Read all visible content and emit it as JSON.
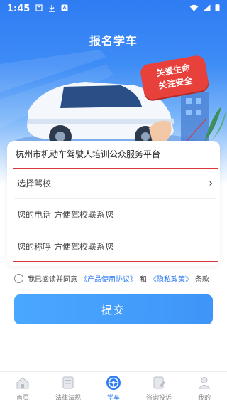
{
  "status_bar": {
    "time": "1:45"
  },
  "header": {
    "title": "报名学车"
  },
  "banner": {
    "badge_line1": "关爱生命",
    "badge_line2": "关注安全"
  },
  "form": {
    "org_name": "杭州市机动车驾驶人培训公众服务平台",
    "school_select": {
      "label": "选择驾校"
    },
    "phone_field": {
      "placeholder": "您的电话 方便驾校联系您"
    },
    "name_field": {
      "placeholder": "您的称呼 方便驾校联系您"
    }
  },
  "agreement": {
    "prefix": "我已阅读并同意",
    "terms_link": "《产品使用协议》",
    "and": "和",
    "privacy_link": "《隐私政策》",
    "suffix": "条款"
  },
  "submit_label": "提交",
  "tabs": [
    {
      "label": "首页",
      "icon": "home-icon"
    },
    {
      "label": "法律法规",
      "icon": "document-icon"
    },
    {
      "label": "学车",
      "icon": "steering-wheel-icon",
      "active": true
    },
    {
      "label": "咨询投诉",
      "icon": "edit-document-icon"
    },
    {
      "label": "我的",
      "icon": "person-icon"
    }
  ],
  "colors": {
    "primary": "#2f7cf3",
    "highlight_border": "#d9363e",
    "badge": "#e8413c"
  }
}
